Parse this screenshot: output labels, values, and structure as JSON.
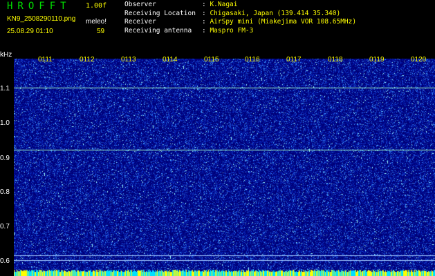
{
  "header": {
    "brand": "HROFFT",
    "version": "1.00f",
    "filename": "KN9_2508290110.png",
    "meleo_label": "meleo!",
    "datetime": "25.08.29 01:10",
    "count": "59"
  },
  "info": [
    {
      "label": "Observer",
      "value": "K.Nagai"
    },
    {
      "label": "Receiving Location",
      "value": "Chigasaki, Japan (139.414 35.340)"
    },
    {
      "label": "Receiver",
      "value": "AirSpy mini (Miakejima VOR 108.65MHz)"
    },
    {
      "label": "Receiving antenna",
      "value": "Maspro FM-3"
    }
  ],
  "axis": {
    "y_unit": "kHz",
    "y_ticks": [
      "1.1",
      "1.0",
      "0.9",
      "0.8",
      "0.7",
      "0.6"
    ],
    "x_ticks": [
      "0111",
      "0112",
      "0113",
      "0114",
      "0115",
      "0116",
      "0117",
      "0118",
      "0119",
      "0120"
    ]
  },
  "colors": {
    "background": "#00008b",
    "noise_bright": "#3fa0ff",
    "noise_cyan": "#a0ffff",
    "carrier_line": "#a0ffc8",
    "label_yellow": "#ffff00",
    "brand_green": "#00e000"
  }
}
